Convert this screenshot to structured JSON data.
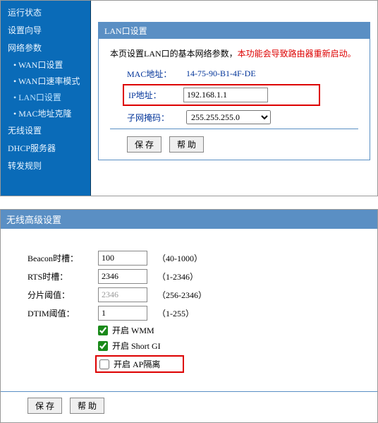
{
  "sidebar": {
    "items": [
      {
        "label": "运行状态"
      },
      {
        "label": "设置向导"
      },
      {
        "label": "网络参数"
      },
      {
        "label": "无线设置"
      },
      {
        "label": "DHCP服务器"
      },
      {
        "label": "转发规则"
      }
    ],
    "subitems": [
      {
        "label": "WAN口设置"
      },
      {
        "label": "WAN口速率模式"
      },
      {
        "label": "LAN口设置"
      },
      {
        "label": "MAC地址克隆"
      }
    ]
  },
  "lan": {
    "title": "LAN口设置",
    "desc_prefix": "本页设置LAN口的基本网络参数，",
    "desc_warn": "本功能会导致路由器重新启动。",
    "mac_label": "MAC地址：",
    "mac_value": "14-75-90-B1-4F-DE",
    "ip_label": "IP地址：",
    "ip_value": "192.168.1.1",
    "mask_label": "子网掩码：",
    "mask_value": "255.255.255.0",
    "save": "保 存",
    "help": "帮 助"
  },
  "wireless": {
    "title": "无线高级设置",
    "beacon_label": "Beacon时槽：",
    "beacon_value": "100",
    "beacon_hint": "（40-1000）",
    "rts_label": "RTS时槽：",
    "rts_value": "2346",
    "rts_hint": "（1-2346）",
    "frag_label": "分片阈值：",
    "frag_value": "2346",
    "frag_hint": "（256-2346）",
    "dtim_label": "DTIM阈值：",
    "dtim_value": "1",
    "dtim_hint": "（1-255）",
    "wmm_label": "开启 WMM",
    "shortgi_label": "开启 Short GI",
    "ap_label": "开启 AP隔离",
    "save": "保 存",
    "help": "帮 助"
  }
}
